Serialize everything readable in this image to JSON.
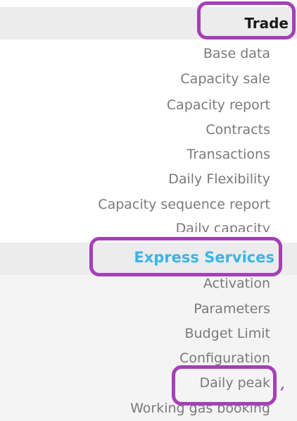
{
  "menu": {
    "heading": "Trade",
    "items": [
      "Base data",
      "Capacity sale",
      "Capacity report",
      "Contracts",
      "Transactions",
      "Daily Flexibility",
      "Capacity sequence report",
      "Daily capacity"
    ],
    "express": {
      "label": "Express Services",
      "items": [
        "Activation",
        "Parameters",
        "Budget Limit",
        "Configuration",
        "Daily peak",
        "Working gas booking"
      ]
    }
  },
  "colors": {
    "highlight": "#a63fb8",
    "express_text": "#3ab4e8",
    "item_text": "#7a7a7a",
    "heading_text": "#1a1a1a",
    "header_bg": "#ececec"
  }
}
